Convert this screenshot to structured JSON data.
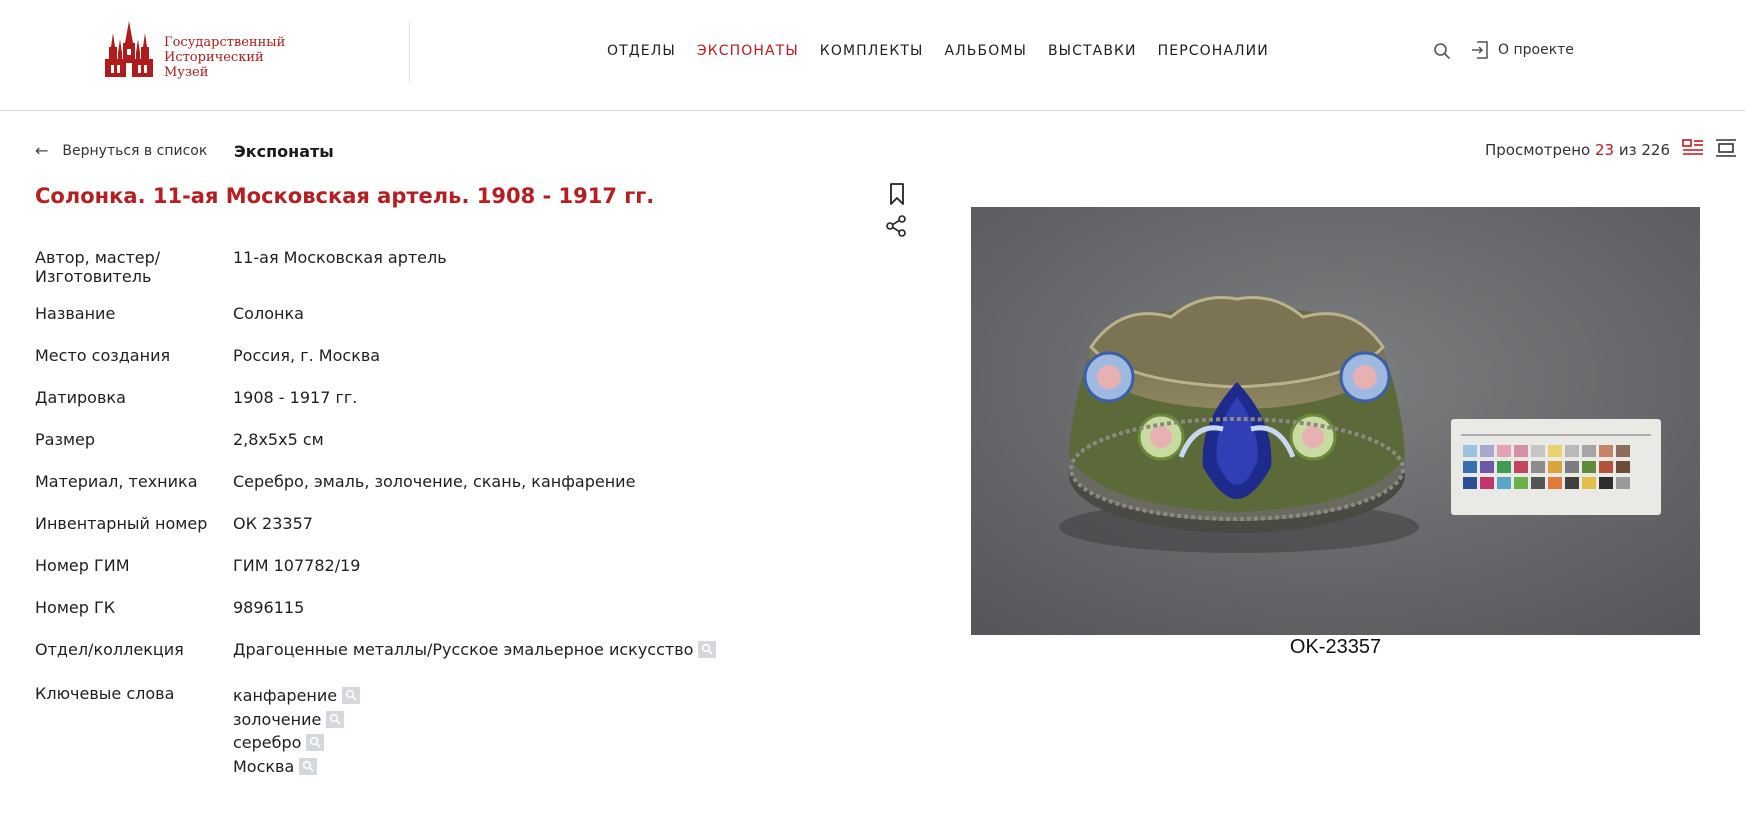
{
  "header": {
    "logo_lines": [
      "Государственный",
      "Исторический",
      "Музей"
    ],
    "nav": [
      {
        "label": "ОТДЕЛЫ",
        "active": false
      },
      {
        "label": "ЭКСПОНАТЫ",
        "active": true
      },
      {
        "label": "КОМПЛЕКТЫ",
        "active": false
      },
      {
        "label": "АЛЬБОМЫ",
        "active": false
      },
      {
        "label": "ВЫСТАВКИ",
        "active": false
      },
      {
        "label": "ПЕРСОНАЛИИ",
        "active": false
      }
    ],
    "about_label": "О проекте",
    "accent_color": "#c1171c"
  },
  "breadcrumb": {
    "back_label": "Вернуться в список",
    "section_title": "Экспонаты"
  },
  "counter": {
    "prefix": "Просмотрено",
    "current": "23",
    "separator": "из",
    "total": "226"
  },
  "item": {
    "title": "Солонка. 11-ая Московская артель. 1908 - 1917 гг.",
    "fields": [
      {
        "label": "Автор, мастер/ Изготовитель",
        "value": "11-ая Московская артель"
      },
      {
        "label": "Название",
        "value": "Солонка"
      },
      {
        "label": "Место создания",
        "value": "Россия, г. Москва"
      },
      {
        "label": "Датировка",
        "value": "1908 - 1917 гг."
      },
      {
        "label": "Размер",
        "value": "2,8х5х5 см"
      },
      {
        "label": "Материал, техника",
        "value": "Серебро, эмаль, золочение, скань, канфарение"
      },
      {
        "label": "Инвентарный номер",
        "value": "ОК 23357"
      },
      {
        "label": "Номер ГИМ",
        "value": "ГИМ 107782/19"
      },
      {
        "label": "Номер ГК",
        "value": "9896115"
      },
      {
        "label": "Отдел/коллекция",
        "value": "Драгоценные металлы/Русское эмальерное искусство"
      }
    ],
    "keywords_label": "Ключевые слова",
    "keywords": [
      "канфарение",
      "золочение",
      "серебро",
      "Москва"
    ],
    "image_caption": "OK-23357"
  }
}
